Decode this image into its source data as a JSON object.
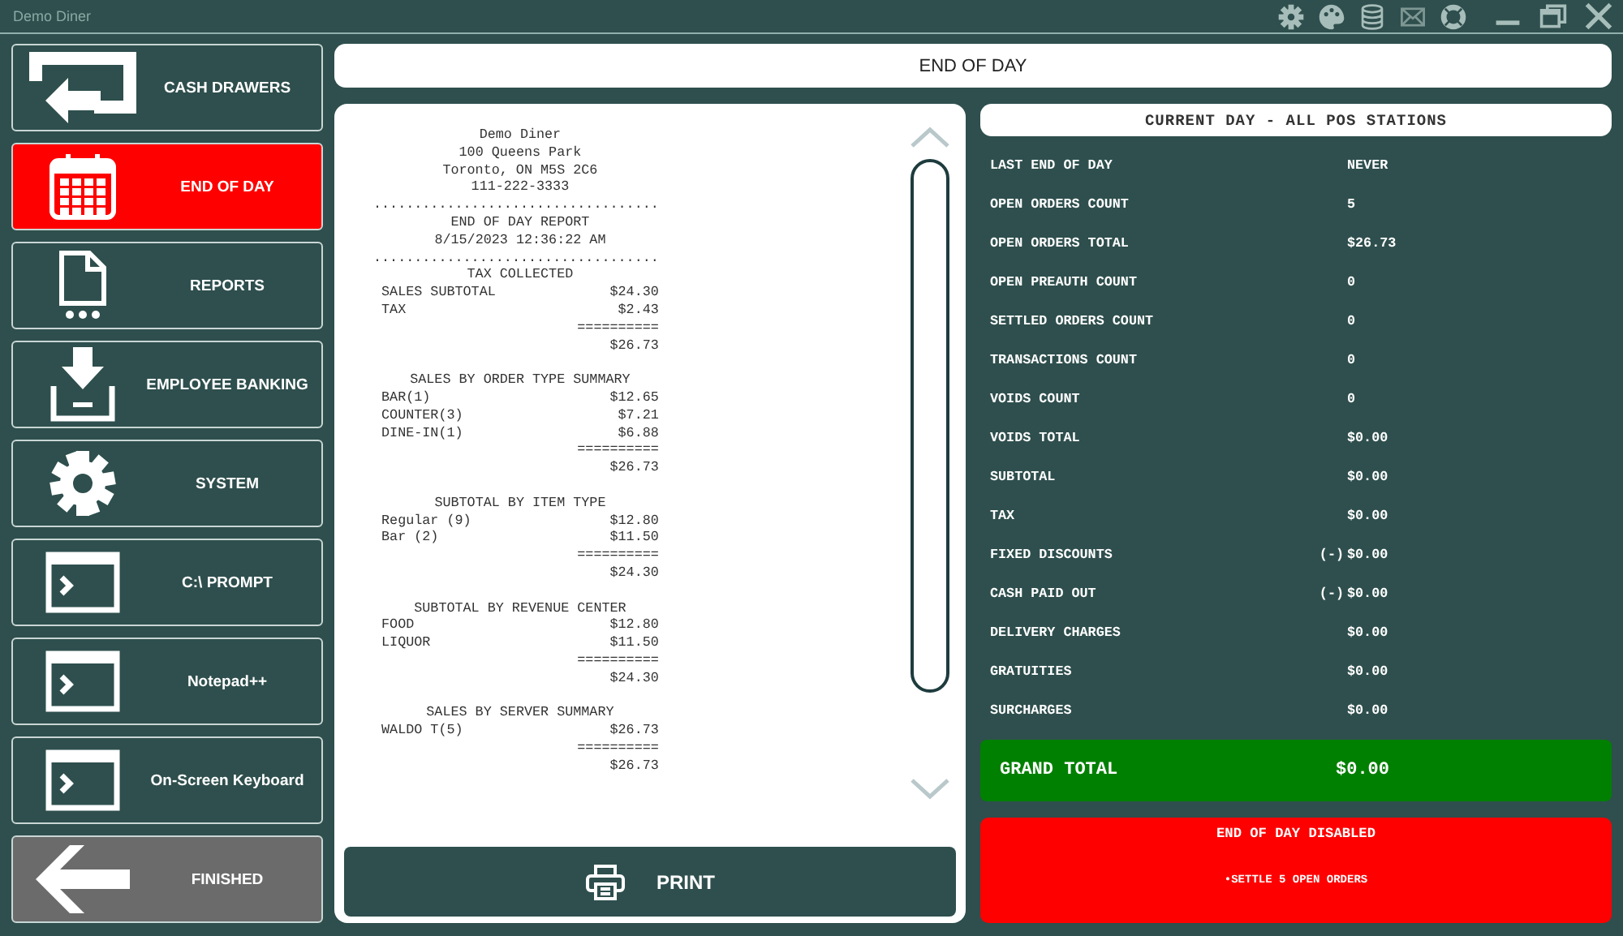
{
  "window": {
    "title": "Demo Diner"
  },
  "toolbar": [
    {
      "kind": "gear",
      "disabled": false
    },
    {
      "kind": "palette",
      "disabled": false
    },
    {
      "kind": "database",
      "disabled": false
    },
    {
      "kind": "mail",
      "disabled": true
    },
    {
      "kind": "lifebuoy",
      "disabled": false
    }
  ],
  "window_controls": [
    {
      "kind": "minimize"
    },
    {
      "kind": "restore"
    },
    {
      "kind": "close"
    }
  ],
  "sidebar": {
    "items": [
      {
        "label": "CASH DRAWERS",
        "kind": "drawer",
        "selected": false
      },
      {
        "label": "END OF DAY",
        "kind": "calendar",
        "selected": true
      },
      {
        "label": "REPORTS",
        "kind": "document",
        "selected": false
      },
      {
        "label": "EMPLOYEE BANKING",
        "kind": "download",
        "selected": false
      },
      {
        "label": "SYSTEM",
        "kind": "gear",
        "selected": false
      },
      {
        "label": "C:\\ PROMPT",
        "kind": "terminal",
        "selected": false
      },
      {
        "label": "Notepad++",
        "kind": "terminal",
        "selected": false
      },
      {
        "label": "On-Screen Keyboard",
        "kind": "terminal",
        "selected": false
      },
      {
        "label": "FINISHED",
        "kind": "exit",
        "selected": false
      }
    ]
  },
  "header": {
    "title": "END OF DAY"
  },
  "receipt": {
    "lines": [
      {
        "kind": "center",
        "text": "Demo Diner"
      },
      {
        "kind": "center",
        "text": "100 Queens Park"
      },
      {
        "kind": "center",
        "text": "Toronto, ON M5S 2C6"
      },
      {
        "kind": "center",
        "text": "111-222-3333"
      },
      {
        "kind": "rule",
        "text": "..................................."
      },
      {
        "kind": "center",
        "text": "END OF DAY REPORT"
      },
      {
        "kind": "center",
        "text": "8/15/2023 12:36:22 AM"
      },
      {
        "kind": "rule",
        "text": "..................................."
      },
      {
        "kind": "center",
        "text": "TAX COLLECTED"
      },
      {
        "kind": "row",
        "label": "SALES SUBTOTAL",
        "amount": "$24.30"
      },
      {
        "kind": "row",
        "label": "TAX",
        "amount": "$2.43"
      },
      {
        "kind": "total",
        "text": "=========="
      },
      {
        "kind": "total",
        "text": "$26.73"
      },
      {
        "kind": "blank"
      },
      {
        "kind": "center",
        "text": "SALES BY ORDER TYPE SUMMARY"
      },
      {
        "kind": "row",
        "label": "BAR(1)",
        "amount": "$12.65"
      },
      {
        "kind": "row",
        "label": "COUNTER(3)",
        "amount": "$7.21"
      },
      {
        "kind": "row",
        "label": "DINE-IN(1)",
        "amount": "$6.88"
      },
      {
        "kind": "total",
        "text": "=========="
      },
      {
        "kind": "total",
        "text": "$26.73"
      },
      {
        "kind": "blank"
      },
      {
        "kind": "center",
        "text": "SUBTOTAL BY ITEM TYPE"
      },
      {
        "kind": "row",
        "label": "Regular (9)",
        "amount": "$12.80"
      },
      {
        "kind": "row",
        "label": "Bar (2)",
        "amount": "$11.50"
      },
      {
        "kind": "total",
        "text": "=========="
      },
      {
        "kind": "total",
        "text": "$24.30"
      },
      {
        "kind": "blank"
      },
      {
        "kind": "center",
        "text": "SUBTOTAL BY REVENUE CENTER"
      },
      {
        "kind": "row",
        "label": "FOOD",
        "amount": "$12.80"
      },
      {
        "kind": "row",
        "label": "LIQUOR",
        "amount": "$11.50"
      },
      {
        "kind": "total",
        "text": "=========="
      },
      {
        "kind": "total",
        "text": "$24.30"
      },
      {
        "kind": "blank"
      },
      {
        "kind": "center",
        "text": "SALES BY SERVER SUMMARY"
      },
      {
        "kind": "row",
        "label": "WALDO T(5)",
        "amount": "$26.73"
      },
      {
        "kind": "total",
        "text": "=========="
      },
      {
        "kind": "total",
        "text": "$26.73"
      }
    ]
  },
  "print_button": {
    "label": "PRINT"
  },
  "summary": {
    "title": "CURRENT DAY - ALL POS STATIONS",
    "rows": [
      {
        "label": "LAST END OF DAY",
        "value": "NEVER"
      },
      {
        "label": "OPEN ORDERS COUNT",
        "value": "5"
      },
      {
        "label": "OPEN ORDERS TOTAL",
        "value": "$26.73"
      },
      {
        "label": "OPEN PREAUTH COUNT",
        "value": "0"
      },
      {
        "label": "SETTLED ORDERS COUNT",
        "value": "0"
      },
      {
        "label": "TRANSACTIONS COUNT",
        "value": "0"
      },
      {
        "label": "VOIDS COUNT",
        "value": "0"
      },
      {
        "label": "VOIDS TOTAL",
        "value": "$0.00"
      },
      {
        "label": "SUBTOTAL",
        "value": "$0.00"
      },
      {
        "label": "TAX",
        "value": "$0.00"
      },
      {
        "label": "FIXED DISCOUNTS",
        "prefix": "(-)",
        "value": "$0.00"
      },
      {
        "label": "CASH PAID OUT",
        "prefix": "(-)",
        "value": "$0.00"
      },
      {
        "label": "DELIVERY CHARGES",
        "value": "$0.00"
      },
      {
        "label": "GRATUITIES",
        "value": "$0.00"
      },
      {
        "label": "SURCHARGES",
        "value": "$0.00"
      }
    ],
    "grand_total": {
      "label": "GRAND TOTAL",
      "value": "$0.00"
    },
    "status": {
      "title": "END OF DAY DISABLED",
      "message": "•SETTLE 5 OPEN ORDERS"
    }
  }
}
